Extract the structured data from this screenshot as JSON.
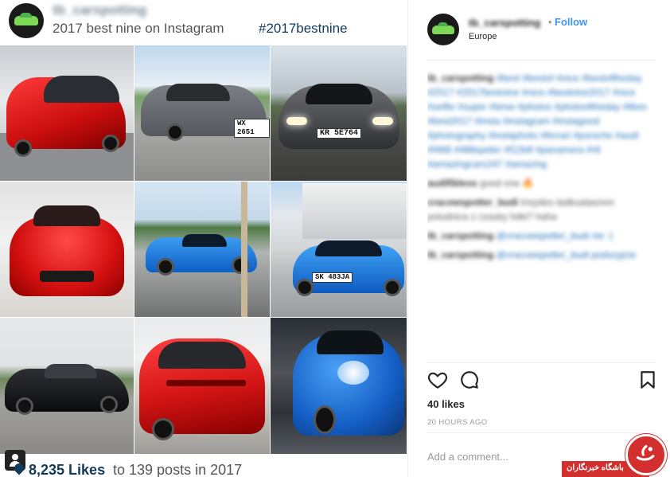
{
  "collage": {
    "username": "tb_carspotting",
    "title": "2017 best nine on Instagram",
    "hashtag": "#2017bestnine",
    "plates": [
      "WX 2651",
      "KR 5E764",
      "SK 483JA"
    ],
    "footer": {
      "likes": "8,235 Likes",
      "text": "to 139 posts in 2017"
    }
  },
  "post": {
    "username": "tb_carspotting",
    "separator": "•",
    "follow_label": "Follow",
    "location": "Europe",
    "comments": [
      {
        "user": "tb_carspotting",
        "text": "#best #bestof #nice #bestoftheday",
        "tags": "#2017 #2017bestnine #nice #bestnine2017 #nice #selfie #super #bmw #photos #photooftheday #likes #best2017 #insta #instagram #instagood #photography #instaphoto #ferrari #porsche #audi #f488 #488spider #f12tdf #panamera #r8 #amazingcars247 #amazing"
      },
      {
        "user": "audifibless",
        "text": "good one 🔥"
      },
      {
        "user": "cracowspotter_budi",
        "text": "Insydes tadkuatasrem poludnica z czasky fotki? haha"
      },
      {
        "user": "tb_carspotting",
        "text": "@cracowspotter_budi nie :)"
      },
      {
        "user": "tb_carspotting",
        "text": "@cracowspotter_budi podszyjcie"
      }
    ],
    "likes": "40 likes",
    "time": "20 HOURS AGO",
    "comment_placeholder": "Add a comment...",
    "icons": [
      "heart-icon",
      "comment-icon",
      "bookmark-icon"
    ]
  },
  "watermark": {
    "text": "باشگاه خبرنگاران",
    "color": "#d42f2f"
  },
  "colors": {
    "follow": "#3897f0",
    "hashtag": "#123a5a",
    "likes_footer": "#123a5a"
  }
}
